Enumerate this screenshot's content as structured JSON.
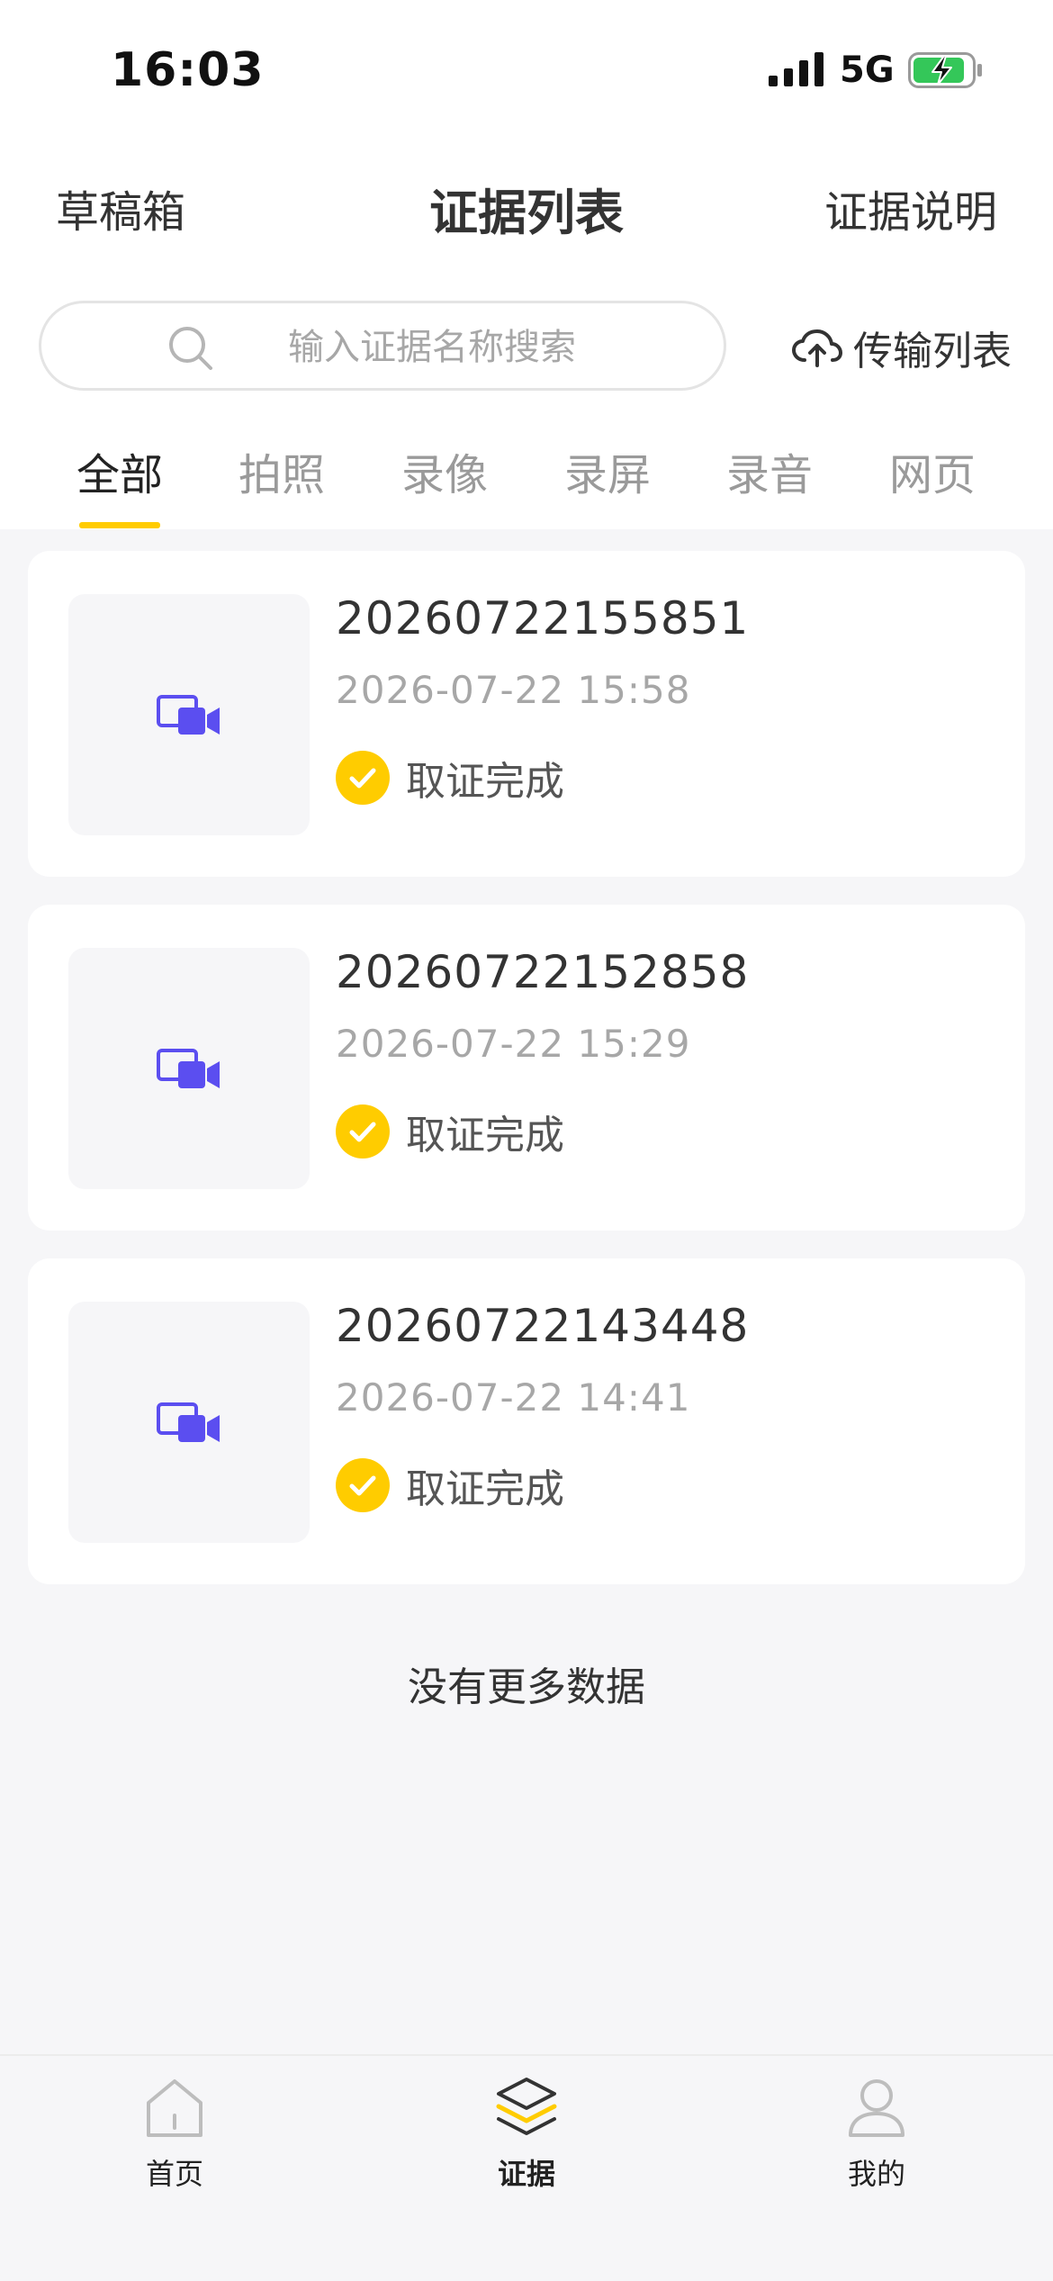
{
  "status_bar": {
    "time": "16:03",
    "network": "5G"
  },
  "header": {
    "left_link": "草稿箱",
    "title": "证据列表",
    "right_link": "证据说明"
  },
  "search": {
    "placeholder": "输入证据名称搜索",
    "value": ""
  },
  "transfer": {
    "label": "传输列表"
  },
  "tabs": [
    {
      "label": "全部",
      "active": true
    },
    {
      "label": "拍照",
      "active": false
    },
    {
      "label": "录像",
      "active": false
    },
    {
      "label": "录屏",
      "active": false
    },
    {
      "label": "录音",
      "active": false
    },
    {
      "label": "网页",
      "active": false
    }
  ],
  "evidence": [
    {
      "name": "20260722155851",
      "time": "2026-07-22 15:58",
      "status": "取证完成",
      "type_icon": "video-camera-icon"
    },
    {
      "name": "20260722152858",
      "time": "2026-07-22 15:29",
      "status": "取证完成",
      "type_icon": "video-camera-icon"
    },
    {
      "name": "20260722143448",
      "time": "2026-07-22 14:41",
      "status": "取证完成",
      "type_icon": "video-camera-icon"
    }
  ],
  "end_notice": "没有更多数据",
  "bottom_nav": [
    {
      "label": "首页",
      "icon": "home-icon",
      "active": false
    },
    {
      "label": "证据",
      "icon": "layers-icon",
      "active": true
    },
    {
      "label": "我的",
      "icon": "profile-icon",
      "active": false
    }
  ],
  "colors": {
    "accent": "#ffcc00",
    "video_icon": "#5b4ef0",
    "background": "#f6f6f8",
    "battery_green": "#34c759"
  }
}
